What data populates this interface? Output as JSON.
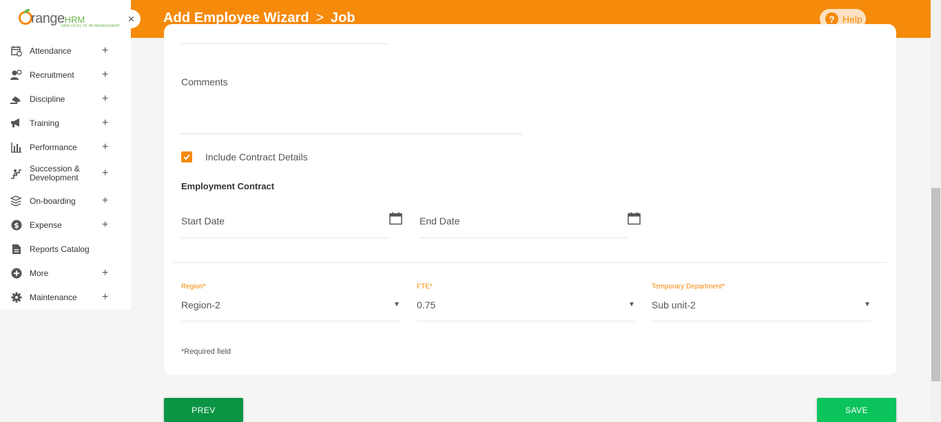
{
  "header": {
    "title": "Add Employee Wizard",
    "separator": ">",
    "step": "Job",
    "help_label": "Help",
    "help_icon_glyph": "?"
  },
  "logo": {
    "brand_main": "range",
    "brand_suffix": "HRM",
    "tagline": "NEW LEVEL OF HR MANAGEMENT"
  },
  "sidebar": {
    "collapse_glyph": "×",
    "items": [
      {
        "label": "Attendance",
        "icon": "calendar-clock-icon",
        "expandable": true
      },
      {
        "label": "Recruitment",
        "icon": "user-plus-icon",
        "expandable": true
      },
      {
        "label": "Discipline",
        "icon": "gavel-icon",
        "expandable": true
      },
      {
        "label": "Training",
        "icon": "megaphone-icon",
        "expandable": true
      },
      {
        "label": "Performance",
        "icon": "bar-chart-icon",
        "expandable": true
      },
      {
        "label": "Succession & Development",
        "icon": "stairs-person-icon",
        "expandable": true
      },
      {
        "label": "On-boarding",
        "icon": "layers-icon",
        "expandable": true
      },
      {
        "label": "Expense",
        "icon": "dollar-circle-icon",
        "expandable": true
      },
      {
        "label": "Reports Catalog",
        "icon": "document-icon",
        "expandable": false
      },
      {
        "label": "More",
        "icon": "plus-circle-icon",
        "expandable": true
      },
      {
        "label": "Maintenance",
        "icon": "gear-icon",
        "expandable": true
      }
    ],
    "plus_glyph": "+"
  },
  "form": {
    "comments_label": "Comments",
    "include_contract_label": "Include Contract Details",
    "include_contract_checked": true,
    "employment_contract_title": "Employment Contract",
    "start_date_label": "Start Date",
    "end_date_label": "End Date",
    "region": {
      "label": "Region",
      "value": "Region-2"
    },
    "fte": {
      "label": "FTE",
      "value": "0.75"
    },
    "temporary_department": {
      "label": "Temporary Department",
      "value": "Sub unit-2"
    },
    "required_marker": "*",
    "required_note": "*Required field",
    "dropdown_arrow": "▼"
  },
  "buttons": {
    "prev": "PREV",
    "save": "SAVE"
  },
  "colors": {
    "brand_orange": "#f58a0b",
    "prev_green": "#0b9444",
    "save_green": "#0bc45c"
  }
}
